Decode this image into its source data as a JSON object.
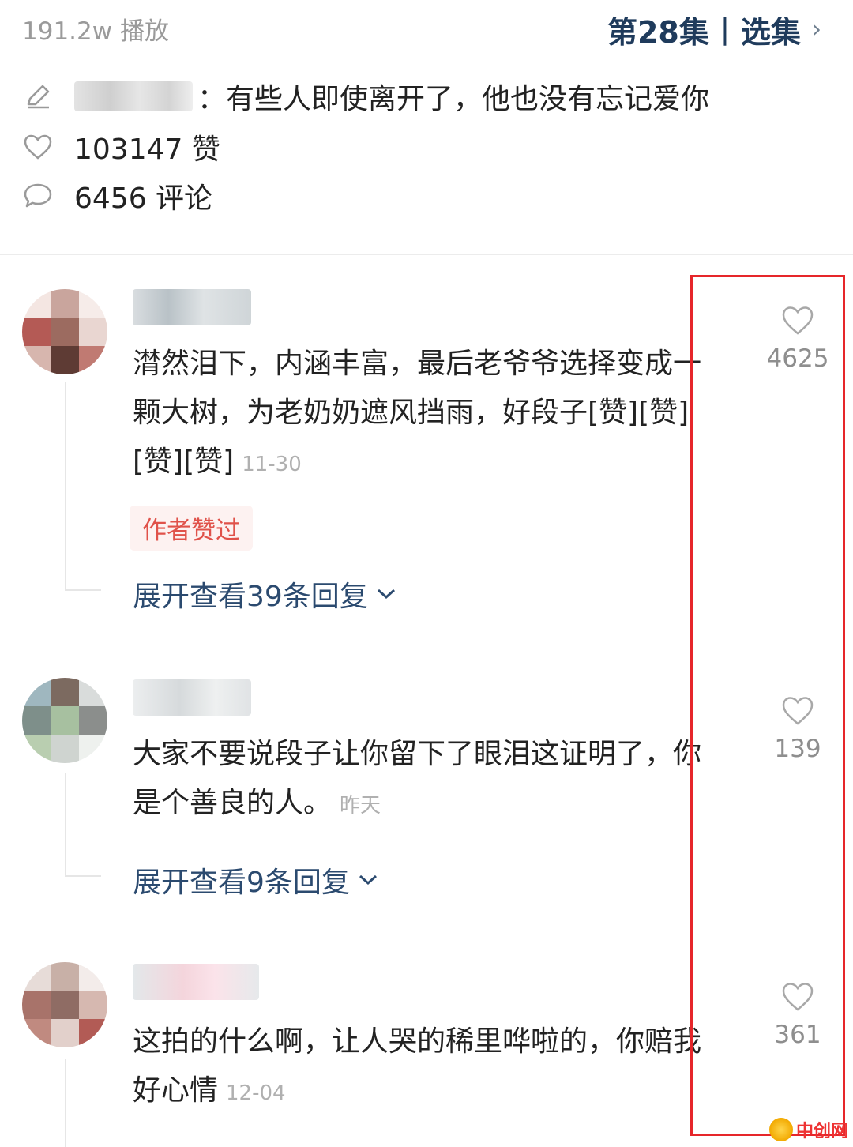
{
  "header": {
    "plays": "191.2w 播放",
    "episode": "第28集",
    "separator": "|",
    "select": "选集",
    "chevron": "›"
  },
  "info": {
    "author_line": "：有些人即使离开了，他也没有忘记爱你",
    "likes": "103147 赞",
    "comments": "6456 评论"
  },
  "comments": [
    {
      "text": "潸然泪下，内涵丰富，最后老爷爷选择变成一颗大树，为老奶奶遮风挡雨，好段子[赞][赞][赞][赞]",
      "time": "11-30",
      "badge": "作者赞过",
      "expand": "展开查看39条回复",
      "likes": "4625"
    },
    {
      "text": "大家不要说段子让你留下了眼泪这证明了，你是个善良的人。",
      "time": "昨天",
      "expand": "展开查看9条回复",
      "likes": "139"
    },
    {
      "text": "这拍的什么啊，让人哭的稀里哗啦的，你赔我好心情",
      "time": "12-04",
      "likes": "361"
    }
  ],
  "watermark": "中创网",
  "colors": {
    "accent": "#1f3b5c",
    "link": "#2b4a6f",
    "badge": "#e0524a",
    "highlight_box": "#e6262a"
  },
  "icons": {
    "edit": "pencil-icon",
    "like": "heart-icon",
    "comment": "comment-bubble-icon",
    "expand": "chevron-down-icon",
    "select": "chevron-right-icon"
  }
}
